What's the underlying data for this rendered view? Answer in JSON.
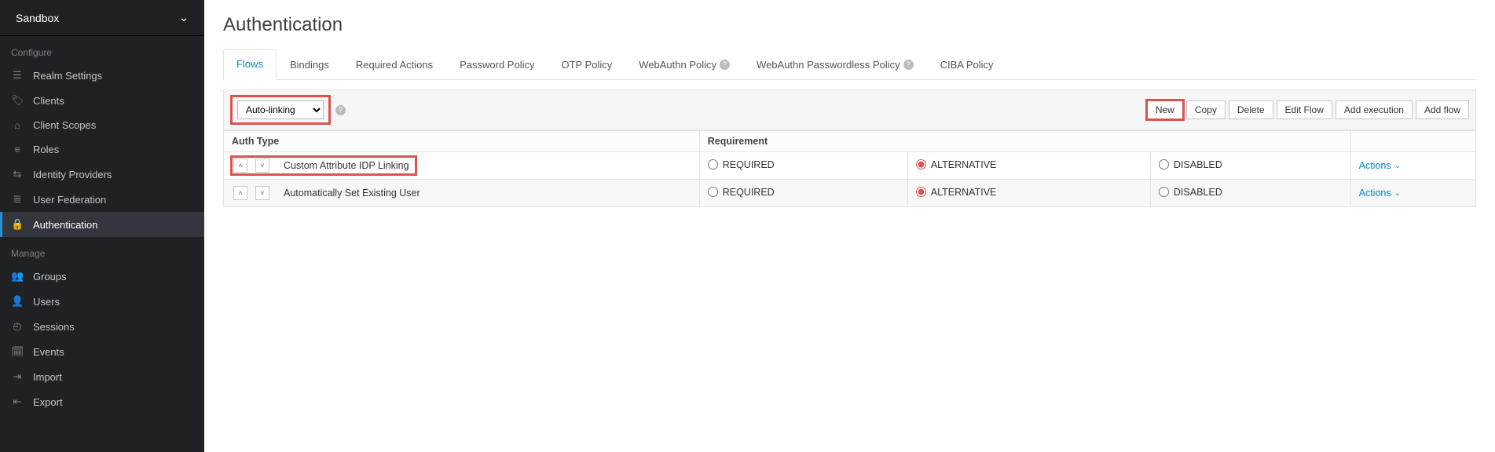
{
  "realm": {
    "name": "Sandbox"
  },
  "sidebar": {
    "configure_label": "Configure",
    "manage_label": "Manage",
    "configure_items": [
      {
        "label": "Realm Settings",
        "icon": "sliders-icon"
      },
      {
        "label": "Clients",
        "icon": "tag-icon"
      },
      {
        "label": "Client Scopes",
        "icon": "clientscope-icon"
      },
      {
        "label": "Roles",
        "icon": "list-icon"
      },
      {
        "label": "Identity Providers",
        "icon": "exchange-icon"
      },
      {
        "label": "User Federation",
        "icon": "database-icon"
      },
      {
        "label": "Authentication",
        "icon": "lock-icon"
      }
    ],
    "manage_items": [
      {
        "label": "Groups",
        "icon": "group-icon"
      },
      {
        "label": "Users",
        "icon": "user-icon"
      },
      {
        "label": "Sessions",
        "icon": "clock-icon"
      },
      {
        "label": "Events",
        "icon": "calendar-icon"
      },
      {
        "label": "Import",
        "icon": "import-icon"
      },
      {
        "label": "Export",
        "icon": "export-icon"
      }
    ]
  },
  "page": {
    "title": "Authentication"
  },
  "tabs": [
    {
      "label": "Flows",
      "help": false,
      "active": true
    },
    {
      "label": "Bindings",
      "help": false
    },
    {
      "label": "Required Actions",
      "help": false
    },
    {
      "label": "Password Policy",
      "help": false
    },
    {
      "label": "OTP Policy",
      "help": false
    },
    {
      "label": "WebAuthn Policy",
      "help": true
    },
    {
      "label": "WebAuthn Passwordless Policy",
      "help": true
    },
    {
      "label": "CIBA Policy",
      "help": false
    }
  ],
  "toolbar": {
    "flow_selected": "Auto-linking",
    "flow_options": [
      "Auto-linking"
    ],
    "buttons": {
      "new": "New",
      "copy": "Copy",
      "delete": "Delete",
      "edit_flow": "Edit Flow",
      "add_execution": "Add execution",
      "add_flow": "Add flow"
    }
  },
  "table": {
    "headers": {
      "auth_type": "Auth Type",
      "requirement": "Requirement",
      "actions_label": "Actions"
    },
    "requirement_options": {
      "required": "REQUIRED",
      "alternative": "ALTERNATIVE",
      "disabled": "DISABLED"
    },
    "rows": [
      {
        "name": "Custom Attribute IDP Linking",
        "requirement": "ALTERNATIVE",
        "highlight": true
      },
      {
        "name": "Automatically Set Existing User",
        "requirement": "ALTERNATIVE",
        "highlight": false
      }
    ]
  }
}
